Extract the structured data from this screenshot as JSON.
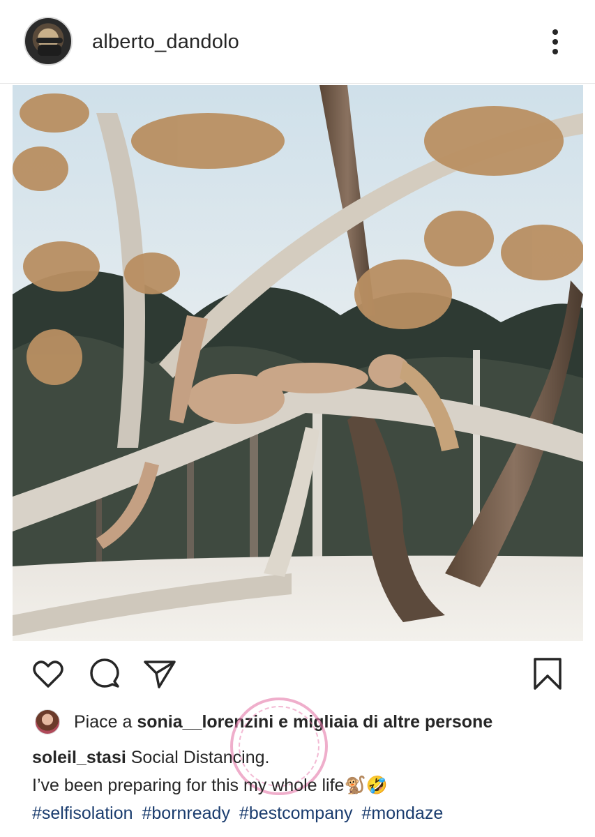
{
  "post": {
    "author_username": "alberto_dandolo",
    "more_options_icon": "more-vertical-icon",
    "photo_icon": "post-photo"
  },
  "actions": {
    "like_icon": "heart-icon",
    "comment_icon": "comment-icon",
    "share_icon": "share-icon",
    "save_icon": "bookmark-icon"
  },
  "likes": {
    "prefix": "Piace a ",
    "user": "sonia__lorenzini",
    "suffix": " e migliaia di altre persone"
  },
  "caption": {
    "username": "soleil_stasi",
    "line1": " Social Distancing.",
    "line2": "I’ve been preparing for this my whole life🐒🤣",
    "hashtags": [
      "#selfisolation",
      "#bornready",
      "#bestcompany",
      "#mondaze"
    ]
  },
  "colors": {
    "text": "#262626",
    "hashtag": "#1a3c6e",
    "watermark_pink": "#e678aa"
  }
}
